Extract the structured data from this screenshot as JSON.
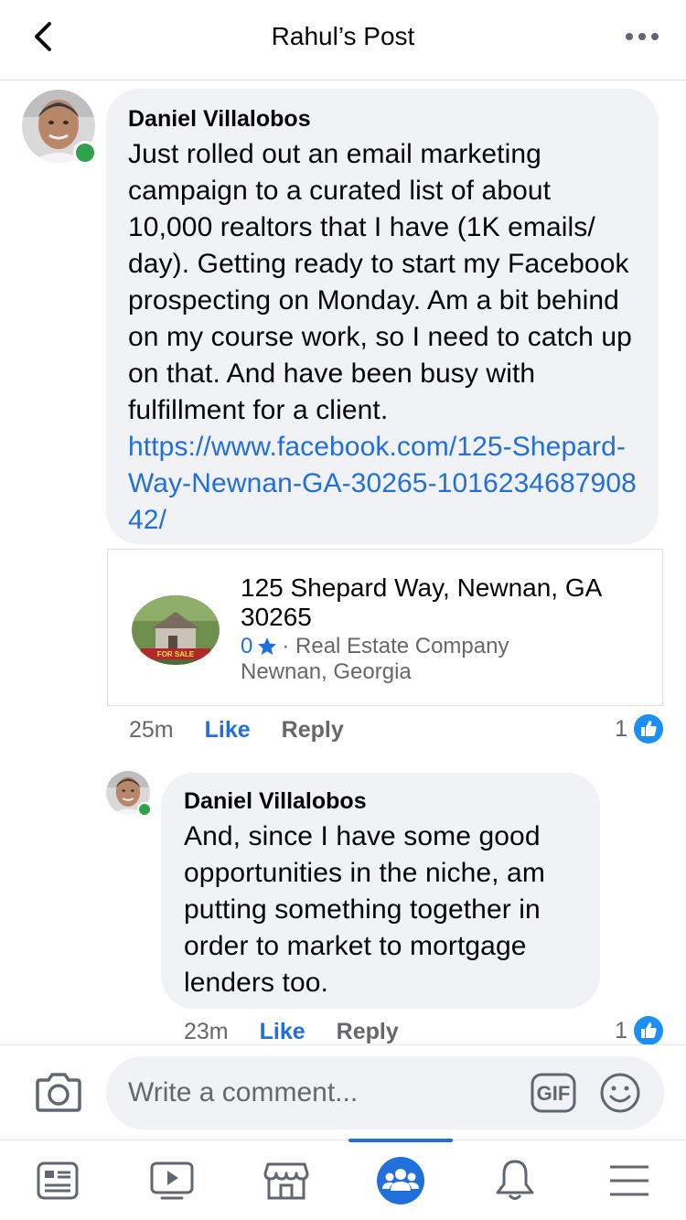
{
  "header": {
    "title": "Rahul’s Post",
    "back_icon": "back-chevron-icon",
    "more_icon": "more-dots-icon"
  },
  "comments": [
    {
      "author": "Daniel Villalobos",
      "text": "Just rolled out an email marketing campaign to a curated list of about 10,000 realtors that I have (1K emails/ day). Getting ready to start my Facebook prospecting on Monday. Am a bit behind on my course work, so I need to catch up on that. And have been busy with fulfillment for a client.",
      "link": "https://www.facebook.com/125-Shepard-Way-Newnan-GA-30265-101623468790842/",
      "time": "25m",
      "like_label": "Like",
      "reply_label": "Reply",
      "reaction_count": "1",
      "online": true
    },
    {
      "author": "Daniel Villalobos",
      "text": "And, since I have some good opportunities in the niche, am putting something together in order to market to mortgage lenders too.",
      "time": "23m",
      "like_label": "Like",
      "reply_label": "Reply",
      "reaction_count": "1",
      "online": true
    }
  ],
  "link_preview": {
    "title": "125 Shepard Way, Newnan, GA 30265",
    "rating": "0",
    "category": "· Real Estate Company",
    "location": "Newnan, Georgia",
    "thumb_badge": "FOR SALE"
  },
  "composer": {
    "placeholder": "Write a comment...",
    "camera_icon": "camera-icon",
    "gif_label": "GIF",
    "emoji_icon": "emoji-icon"
  },
  "tabbar": {
    "tabs": [
      {
        "name": "news-feed",
        "icon": "news-feed-icon"
      },
      {
        "name": "watch",
        "icon": "video-play-icon"
      },
      {
        "name": "marketplace",
        "icon": "marketplace-icon"
      },
      {
        "name": "groups",
        "icon": "groups-icon",
        "active": true
      },
      {
        "name": "notifications",
        "icon": "bell-icon"
      },
      {
        "name": "menu",
        "icon": "menu-icon"
      }
    ]
  },
  "colors": {
    "accent": "#216fdb",
    "bubble": "#f0f2f5",
    "secondary_text": "#65676b",
    "online": "#31a24c"
  }
}
